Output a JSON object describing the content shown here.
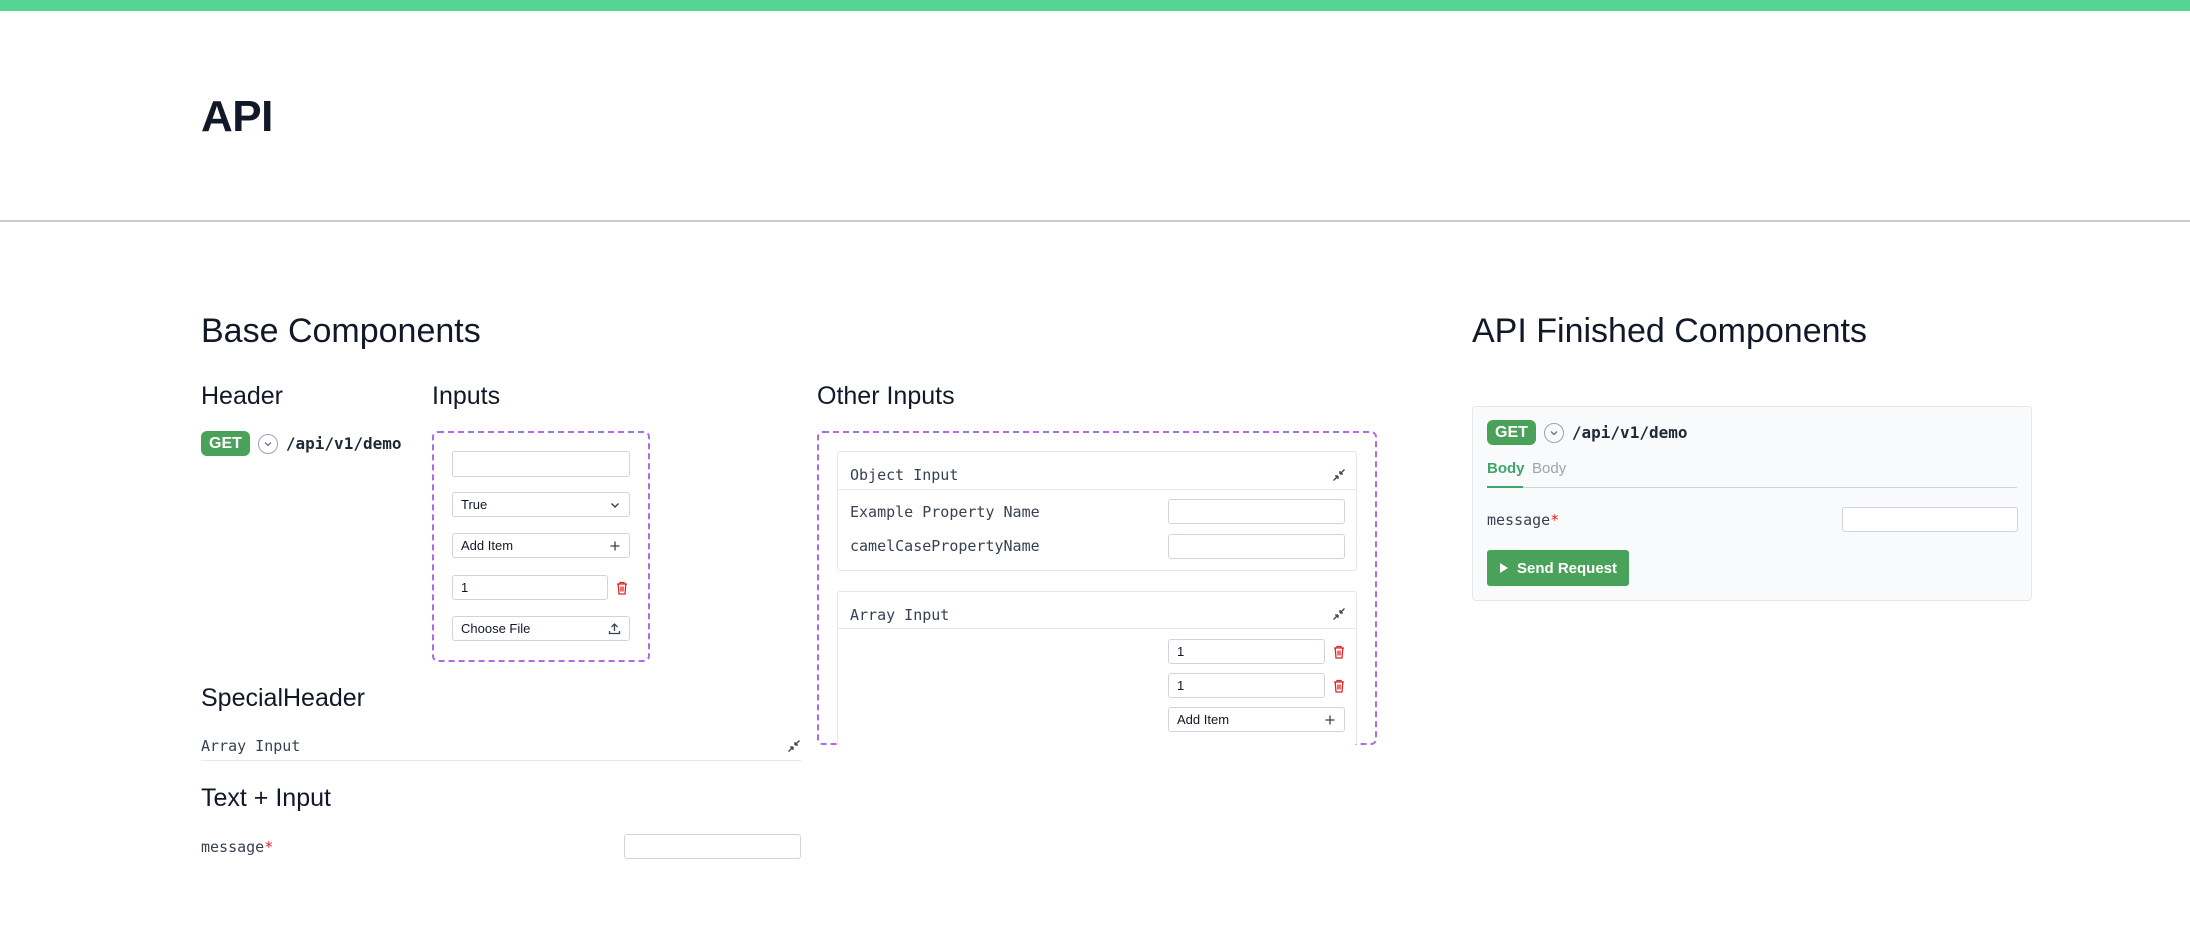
{
  "page": {
    "title": "API"
  },
  "sections": {
    "base": "Base Components",
    "finished": "API Finished Components"
  },
  "header_demo": {
    "heading": "Header",
    "method": "GET",
    "path": "/api/v1/demo"
  },
  "inputs_demo": {
    "heading": "Inputs",
    "text_value": "",
    "select_value": "True",
    "add_item_label": "Add Item",
    "number_value": "1",
    "file_label": "Choose File"
  },
  "other_inputs": {
    "heading": "Other Inputs",
    "object_input": {
      "title": "Object Input",
      "fields": [
        {
          "label": "Example Property Name",
          "value": ""
        },
        {
          "label": "camelCasePropertyName",
          "value": ""
        }
      ]
    },
    "array_input": {
      "title": "Array Input",
      "items": [
        "1",
        "1"
      ],
      "add_item_label": "Add Item"
    }
  },
  "special_header": {
    "heading": "SpecialHeader",
    "title": "Array Input"
  },
  "text_input": {
    "heading": "Text + Input",
    "label": "message",
    "required_mark": "*",
    "value": ""
  },
  "finished": {
    "method": "GET",
    "path": "/api/v1/demo",
    "tabs": [
      {
        "label": "Body",
        "active": true
      },
      {
        "label": "Body",
        "active": false
      }
    ],
    "field_label": "message",
    "required_mark": "*",
    "field_value": "",
    "send_label": "Send Request"
  },
  "colors": {
    "accent": "#55d494",
    "get_badge": "#4aa25a",
    "dashed_border": "#b06ae8",
    "danger": "#dc2626",
    "active_tab": "#3fa56a"
  }
}
